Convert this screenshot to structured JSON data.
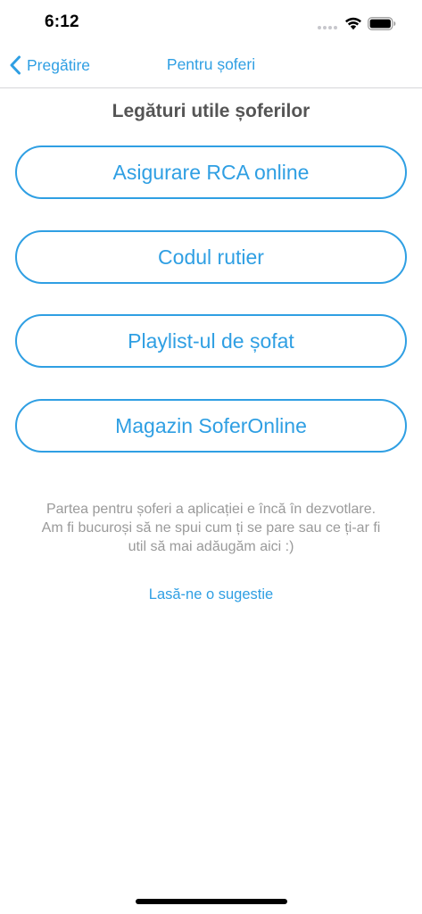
{
  "status_bar": {
    "time": "6:12"
  },
  "nav": {
    "back_label": "Pregătire",
    "title": "Pentru șoferi"
  },
  "content": {
    "section_title": "Legături utile șoferilor",
    "links": [
      {
        "label": "Asigurare RCA online"
      },
      {
        "label": "Codul rutier"
      },
      {
        "label": "Playlist-ul de șofat"
      },
      {
        "label": "Magazin SoferOnline"
      }
    ],
    "info_lines": [
      "Partea pentru șoferi a aplicației e încă în dezvotlare.",
      "Am fi bucuroși să ne spui cum ți se pare sau ce ți-ar fi",
      "util să mai adăugăm aici :)"
    ],
    "suggest_label": "Lasă-ne o sugestie"
  },
  "colors": {
    "accent": "#2f9fe3",
    "title_text": "#555555",
    "muted_text": "#9a9a9a"
  },
  "icons": {
    "back": "chevron-left-icon",
    "signal": "cellular-signal-icon",
    "wifi": "wifi-icon",
    "battery": "battery-icon"
  }
}
